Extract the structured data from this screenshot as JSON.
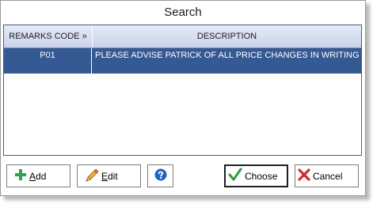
{
  "window": {
    "title": "Search"
  },
  "grid": {
    "columns": [
      "REMARKS CODE »",
      "DESCRIPTION"
    ],
    "rows": [
      {
        "code": "P01",
        "description": "PLEASE ADVISE PATRICK OF ALL PRICE CHANGES IN WRITING"
      }
    ]
  },
  "buttons": {
    "add": {
      "mnemonic": "A",
      "rest": "dd",
      "icon": "plus-icon"
    },
    "edit": {
      "mnemonic": "E",
      "rest": "dit",
      "icon": "pencil-icon"
    },
    "help": {
      "icon": "help-icon"
    },
    "choose": {
      "label": "Choose",
      "icon": "checkmark-icon"
    },
    "cancel": {
      "label": "Cancel",
      "icon": "x-icon"
    }
  },
  "colors": {
    "selection": "#355993",
    "header": "#c8d2ea",
    "add_icon": "#2fa24e",
    "help_icon": "#1e64c8",
    "check_icon": "#2f9b45",
    "cancel_icon": "#cf2b2b"
  }
}
